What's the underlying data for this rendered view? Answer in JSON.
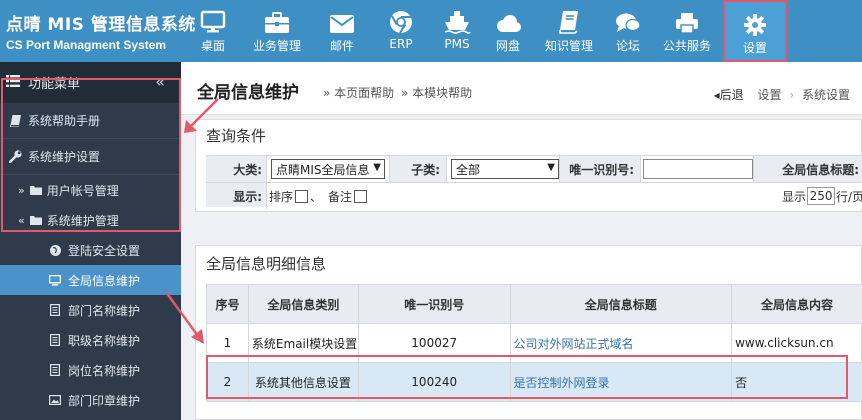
{
  "brand": {
    "title_cn": "点晴 MIS 管理信息系统",
    "title_en": "CS Port Managment System"
  },
  "nav": [
    {
      "label": "桌面",
      "icon": "desktop-icon"
    },
    {
      "label": "业务管理",
      "icon": "briefcase-icon"
    },
    {
      "label": "邮件",
      "icon": "mail-icon"
    },
    {
      "label": "ERP",
      "icon": "chrome-icon"
    },
    {
      "label": "PMS",
      "icon": "ship-icon"
    },
    {
      "label": "网盘",
      "icon": "cloud-icon"
    },
    {
      "label": "知识管理",
      "icon": "book-icon"
    },
    {
      "label": "论坛",
      "icon": "chat-icon"
    },
    {
      "label": "公共服务",
      "icon": "printer-icon"
    },
    {
      "label": "设置",
      "icon": "gear-icon",
      "active": true
    }
  ],
  "sidebar": {
    "header": "功能菜单",
    "collapse_symbol": "«",
    "help": "系统帮助手册",
    "section": "系统维护设置",
    "groups": [
      {
        "label": "用户帐号管理",
        "expander": "»"
      },
      {
        "label": "系统维护管理",
        "expander": "«"
      }
    ],
    "items": [
      {
        "label": "登陆安全设置",
        "icon": "globe-icon"
      },
      {
        "label": "全局信息维护",
        "icon": "monitor-icon",
        "active": true
      },
      {
        "label": "部门名称维护",
        "icon": "list-icon"
      },
      {
        "label": "职级名称维护",
        "icon": "list-icon"
      },
      {
        "label": "岗位名称维护",
        "icon": "list-icon"
      },
      {
        "label": "部门印章维护",
        "icon": "image-icon"
      }
    ]
  },
  "header": {
    "title": "全局信息维护",
    "help_page": "» 本页面帮助",
    "help_module": "» 本模块帮助",
    "back": "后退",
    "breadcrumb": [
      "设置",
      "系统设置"
    ]
  },
  "query": {
    "title": "查询条件",
    "category_label": "大类:",
    "category_value": "点睛MIS全局信息",
    "subcategory_label": "子类:",
    "subcategory_value": "全部",
    "unique_id_label": "唯一识别号:",
    "unique_id_value": "",
    "global_title_label": "全局信息标题:",
    "display_label": "显示:",
    "sort_label": "排序",
    "sep": "、",
    "note_label": "备注",
    "page_size_prefix": "显示",
    "page_size_value": "250",
    "page_size_suffix": "行/页"
  },
  "detail": {
    "title": "全局信息明细信息",
    "columns": [
      "序号",
      "全局信息类别",
      "唯一识别号",
      "全局信息标题",
      "全局信息内容"
    ],
    "rows": [
      {
        "no": "1",
        "category": "系统Email模块设置",
        "uid": "100027",
        "title": "公司对外网站正式域名",
        "content": "www.clicksun.cn"
      },
      {
        "no": "2",
        "category": "系统其他信息设置",
        "uid": "100240",
        "title": "是否控制外网登录",
        "content": "否",
        "selected": true
      }
    ]
  },
  "colors": {
    "topbar": "#3d8fc4",
    "sidebar": "#2f3b4a",
    "accent": "#4a92c9",
    "highlight_border": "#e05a6a"
  }
}
